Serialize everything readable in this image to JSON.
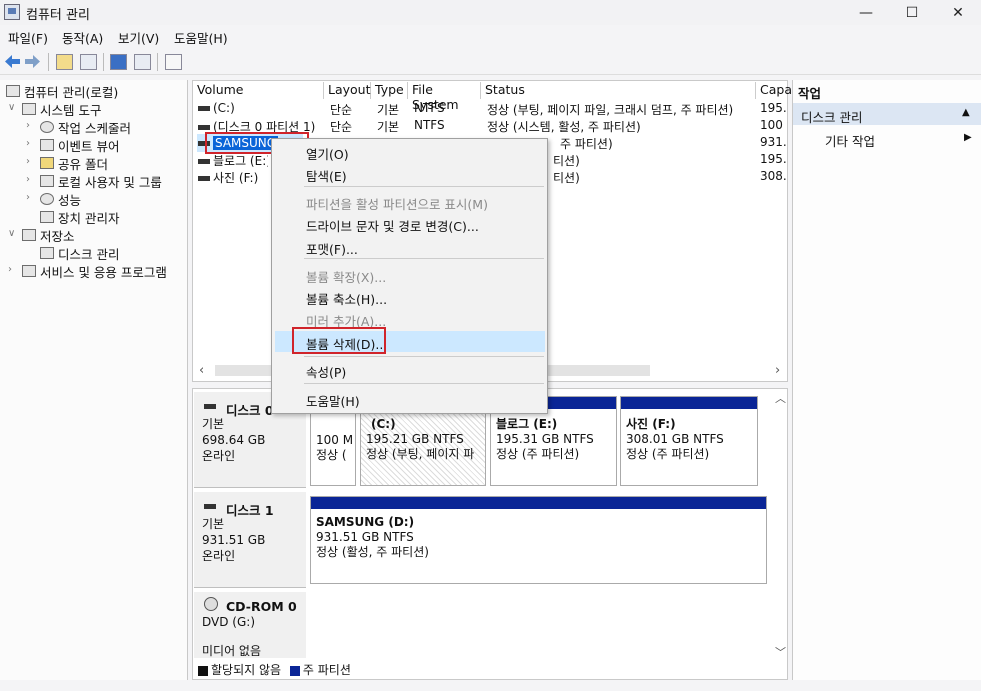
{
  "window": {
    "title": "컴퓨터 관리",
    "minimize": "—",
    "maximize": "☐",
    "close": "✕"
  },
  "menu": [
    "파일(F)",
    "동작(A)",
    "보기(V)",
    "도움말(H)"
  ],
  "tree": {
    "root": "컴퓨터 관리(로컬)",
    "system_tools": "시스템 도구",
    "task_scheduler": "작업 스케줄러",
    "event_viewer": "이벤트 뷰어",
    "shared_folders": "공유 폴더",
    "local_users": "로컬 사용자 및 그룹",
    "performance": "성능",
    "device_manager": "장치 관리자",
    "storage": "저장소",
    "disk_management": "디스크 관리",
    "services": "서비스 및 응용 프로그램"
  },
  "list": {
    "columns": [
      "Volume",
      "Layout",
      "Type",
      "File System",
      "Status",
      "Capa"
    ],
    "rows": [
      {
        "volume": "(C:)",
        "layout": "단순",
        "type": "기본",
        "fs": "NTFS",
        "status": "정상 (부팅, 페이지 파일, 크래시 덤프, 주 파티션)",
        "capacity": "195.2"
      },
      {
        "volume": "(디스크 0 파티션 1)",
        "layout": "단순",
        "type": "기본",
        "fs": "NTFS",
        "status": "정상 (시스템, 활성, 주 파티션)",
        "capacity": "100 M"
      },
      {
        "volume": "SAMSUNG",
        "layout": "",
        "type": "",
        "fs": "",
        "status": "주 파티션)",
        "capacity": "931.5"
      },
      {
        "volume": "블로그 (E:)",
        "layout": "",
        "type": "",
        "fs": "",
        "status": "티션)",
        "capacity": "195.3"
      },
      {
        "volume": "사진 (F:)",
        "layout": "",
        "type": "",
        "fs": "",
        "status": "티션)",
        "capacity": "308.0"
      }
    ]
  },
  "context_menu": {
    "open": "열기(O)",
    "explore": "탐색(E)",
    "mark_active": "파티션을 활성 파티션으로 표시(M)",
    "change_letter": "드라이브 문자 및 경로 변경(C)...",
    "format": "포맷(F)...",
    "extend": "볼륨 확장(X)...",
    "shrink": "볼륨 축소(H)...",
    "mirror": "미러 추가(A)...",
    "delete": "볼륨 삭제(D)...",
    "properties": "속성(P)",
    "help": "도움말(H)"
  },
  "disks": [
    {
      "name": "디스크 0",
      "type": "기본",
      "size": "698.64 GB",
      "state": "온라인",
      "partitions": [
        {
          "label": "",
          "size": "100 M",
          "status": "정상 ("
        },
        {
          "label": "(C:)",
          "size": "195.21 GB NTFS",
          "status": "정상 (부팅, 페이지 파"
        },
        {
          "label": "블로그  (E:)",
          "size": "195.31 GB NTFS",
          "status": "정상 (주 파티션)"
        },
        {
          "label": "사진  (F:)",
          "size": "308.01 GB NTFS",
          "status": "정상 (주 파티션)"
        }
      ]
    },
    {
      "name": "디스크 1",
      "type": "기본",
      "size": "931.51 GB",
      "state": "온라인",
      "partitions": [
        {
          "label": "SAMSUNG  (D:)",
          "size": "931.51 GB NTFS",
          "status": "정상 (활성, 주 파티션)"
        }
      ]
    },
    {
      "name": "CD-ROM 0",
      "type": "DVD (G:)",
      "size": "",
      "state": "미디어 없음",
      "partitions": []
    }
  ],
  "legend": {
    "unallocated": "할당되지 않음",
    "primary": "주 파티션"
  },
  "actions": {
    "header": "작업",
    "section": "디스크 관리",
    "more": "기타 작업"
  },
  "colors": {
    "primary_partition": "#0a2596",
    "selection": "#cce8ff",
    "highlight_border": "#d0242b",
    "action_header": "#dce6f3"
  }
}
